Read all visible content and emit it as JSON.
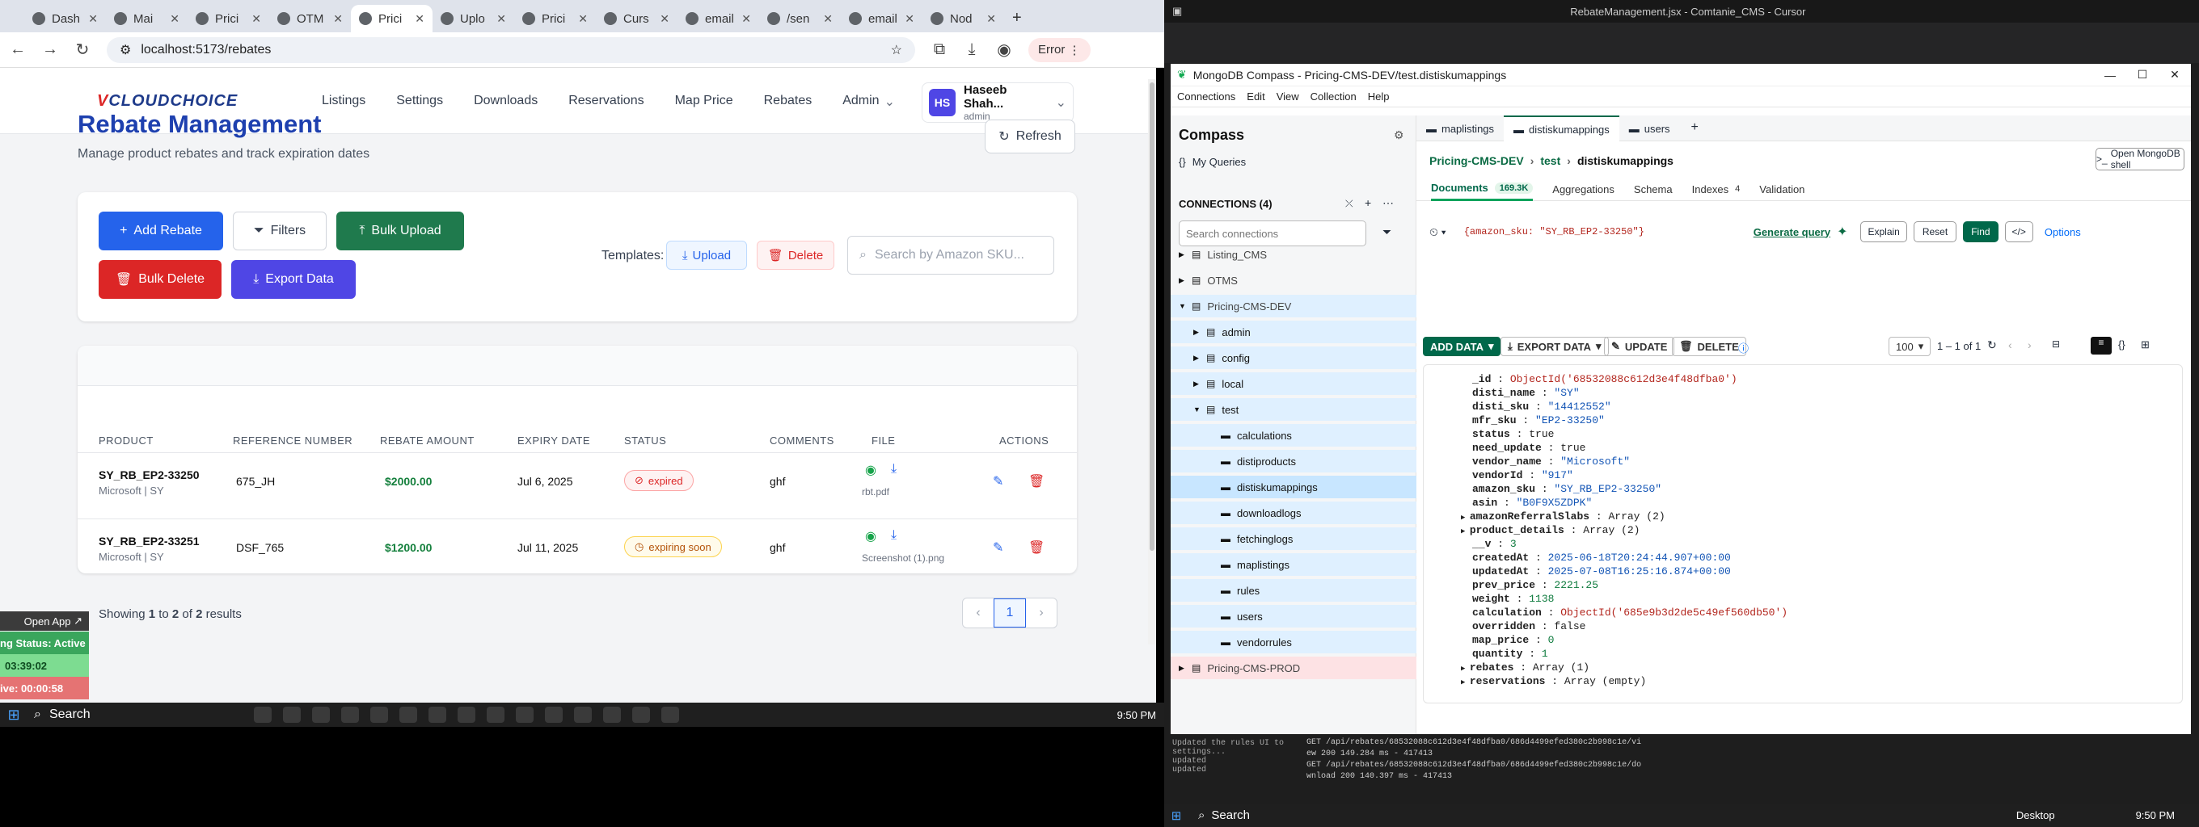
{
  "browser": {
    "tabs": [
      "Dash",
      "Mai",
      "Prici",
      "OTM",
      "Prici",
      "Uplo",
      "Prici",
      "Curs",
      "email",
      "/sen",
      "email",
      "Nod"
    ],
    "url": "localhost:5173/rebates",
    "error_label": "Error"
  },
  "app": {
    "logo_prefix": "V",
    "logo_text": "CLOUDCHOICE",
    "nav": [
      "Listings",
      "Settings",
      "Downloads",
      "Reservations",
      "Map Price",
      "Rebates",
      "Admin"
    ],
    "user": {
      "initials": "HS",
      "name": "Haseeb Shah...",
      "role": "admin"
    },
    "title": "Rebate Management",
    "subtitle": "Manage product rebates and track expiration dates",
    "refresh": "Refresh",
    "buttons": {
      "add": "Add Rebate",
      "filters": "Filters",
      "bulk_upload": "Bulk Upload",
      "bulk_delete": "Bulk Delete",
      "export": "Export Data"
    },
    "templates_label": "Templates:",
    "template_upload": "Upload",
    "template_delete": "Delete",
    "search_placeholder": "Search by Amazon SKU...",
    "columns": [
      "PRODUCT",
      "REFERENCE NUMBER",
      "REBATE AMOUNT",
      "EXPIRY DATE",
      "STATUS",
      "COMMENTS",
      "FILE",
      "ACTIONS"
    ],
    "rows": [
      {
        "product": "SY_RB_EP2-33250",
        "sub": "Microsoft | SY",
        "ref": "675_JH",
        "amount": "$2000.00",
        "expiry": "Jul 6, 2025",
        "status": "expired",
        "comments": "ghf",
        "file": "rbt.pdf"
      },
      {
        "product": "SY_RB_EP2-33251",
        "sub": "Microsoft | SY",
        "ref": "DSF_765",
        "amount": "$1200.00",
        "expiry": "Jul 11, 2025",
        "status": "expiring soon",
        "comments": "ghf",
        "file": "Screenshot (1).png"
      }
    ],
    "pagination_text_pre": "Showing ",
    "pagination_from": "1",
    "pagination_mid": " to ",
    "pagination_to": "2",
    "pagination_of": " of ",
    "pagination_total": "2",
    "pagination_suffix": " results",
    "page": "1",
    "widget": {
      "open_app": "Open App",
      "status": "ng Status: Active",
      "time1": "03:39:02",
      "time2": "ive: 00:00:58"
    }
  },
  "taskbar": {
    "search": "Search",
    "time": "9:50 PM"
  },
  "compass": {
    "window_title": "MongoDB Compass - Pricing-CMS-DEV/test.distiskumappings",
    "editor_title": "RebateManagement.jsx - Comtanie_CMS - Cursor",
    "menu": [
      "Connections",
      "Edit",
      "View",
      "Collection",
      "Help"
    ],
    "sidebar_title": "Compass",
    "my_queries": "My Queries",
    "connections_label": "CONNECTIONS (4)",
    "search_connections": "Search connections",
    "tree": [
      {
        "label": "Listing_CMS",
        "level": 0
      },
      {
        "label": "OTMS",
        "level": 0
      },
      {
        "label": "Pricing-CMS-DEV",
        "level": 0
      },
      {
        "label": "admin",
        "level": 1
      },
      {
        "label": "config",
        "level": 1
      },
      {
        "label": "local",
        "level": 1
      },
      {
        "label": "test",
        "level": 1
      },
      {
        "label": "calculations",
        "level": 2
      },
      {
        "label": "distiproducts",
        "level": 2
      },
      {
        "label": "distiskumappings",
        "level": 2
      },
      {
        "label": "downloadlogs",
        "level": 2
      },
      {
        "label": "fetchinglogs",
        "level": 2
      },
      {
        "label": "maplistings",
        "level": 2
      },
      {
        "label": "rules",
        "level": 2
      },
      {
        "label": "users",
        "level": 2
      },
      {
        "label": "vendorrules",
        "level": 2
      },
      {
        "label": "Pricing-CMS-PROD",
        "level": 0
      }
    ],
    "tabs": [
      "maplistings",
      "distiskumappings",
      "users"
    ],
    "breadcrumb": [
      "Pricing-CMS-DEV",
      "test",
      "distiskumappings"
    ],
    "open_shell": "Open MongoDB shell",
    "subtabs": [
      "Documents",
      "Aggregations",
      "Schema",
      "Indexes",
      "Validation"
    ],
    "doc_count": "169.3K",
    "index_count": "4",
    "query": "{amazon_sku: \"SY_RB_EP2-33250\"}",
    "generate_query": "Generate query",
    "explain": "Explain",
    "reset": "Reset",
    "find": "Find",
    "options": "Options",
    "add_data": "ADD DATA",
    "export_data": "EXPORT DATA",
    "update": "UPDATE",
    "delete": "DELETE",
    "page_size": "100",
    "range": "1 – 1 of 1",
    "document": [
      {
        "k": "_id",
        "v": "ObjectId('68532088c612d3e4f48dfba0')",
        "t": "o"
      },
      {
        "k": "disti_name",
        "v": "\"SY\"",
        "t": "s"
      },
      {
        "k": "disti_sku",
        "v": "\"14412552\"",
        "t": "s"
      },
      {
        "k": "mfr_sku",
        "v": "\"EP2-33250\"",
        "t": "s"
      },
      {
        "k": "status",
        "v": "true",
        "t": "k"
      },
      {
        "k": "need_update",
        "v": "true",
        "t": "k"
      },
      {
        "k": "vendor_name",
        "v": "\"Microsoft\"",
        "t": "s"
      },
      {
        "k": "vendorId",
        "v": "\"917\"",
        "t": "s"
      },
      {
        "k": "amazon_sku",
        "v": "\"SY_RB_EP2-33250\"",
        "t": "s"
      },
      {
        "k": "asin",
        "v": "\"B0F9X5ZDPK\"",
        "t": "s"
      },
      {
        "k": "amazonReferralSlabs",
        "v": "Array (2)",
        "t": "k",
        "expand": true
      },
      {
        "k": "product_details",
        "v": "Array (2)",
        "t": "k",
        "expand": true
      },
      {
        "k": "__v",
        "v": "3",
        "t": "n"
      },
      {
        "k": "createdAt",
        "v": "2025-06-18T20:24:44.907+00:00",
        "t": "s"
      },
      {
        "k": "updatedAt",
        "v": "2025-07-08T16:25:16.874+00:00",
        "t": "s"
      },
      {
        "k": "prev_price",
        "v": "2221.25",
        "t": "n"
      },
      {
        "k": "weight",
        "v": "1138",
        "t": "n"
      },
      {
        "k": "calculation",
        "v": "ObjectId('685e9b3d2de5c49ef560db50')",
        "t": "o"
      },
      {
        "k": "overridden",
        "v": "false",
        "t": "k"
      },
      {
        "k": "map_price",
        "v": "0",
        "t": "n"
      },
      {
        "k": "quantity",
        "v": "1",
        "t": "n"
      },
      {
        "k": "rebates",
        "v": "Array (1)",
        "t": "k",
        "expand": true
      },
      {
        "k": "reservations",
        "v": "Array (empty)",
        "t": "k",
        "expand": true
      }
    ],
    "terminal": [
      "GET /api/rebates/68532088c612d3e4f48dfba0/686d4499efed380c2b998c1e/vi",
      "ew 200 149.284 ms - 417413",
      "GET /api/rebates/68532088c612d3e4f48dfba0/686d4499efed380c2b998c1e/do",
      "wnload 200 140.397 ms - 417413"
    ],
    "chat_lines": [
      "Updated the rules UI to settings...",
      "updated",
      "updated"
    ],
    "taskbar_search": "Search",
    "desktop": "Desktop",
    "time": "9:50 PM"
  }
}
